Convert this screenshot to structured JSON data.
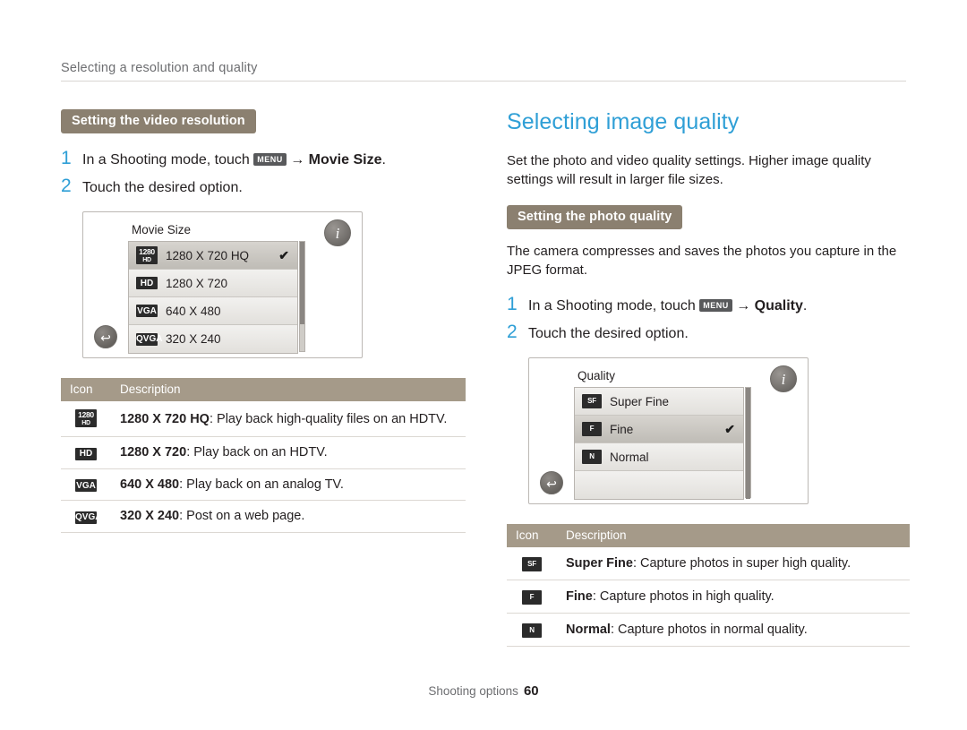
{
  "runhead": {
    "text": "Selecting a resolution and quality"
  },
  "left": {
    "section_tab": "Setting the video resolution",
    "steps": [
      {
        "num": "1",
        "pre": "In a Shooting mode, touch",
        "chip": "MENU",
        "arrow": "→",
        "bold": "Movie Size",
        "post": "."
      },
      {
        "num": "2",
        "pre": "Touch the desired option.",
        "chip": "",
        "arrow": "",
        "bold": "",
        "post": ""
      }
    ],
    "screen": {
      "title": "Movie Size",
      "info_label": "i",
      "back_label": "↩",
      "options": [
        {
          "icon_top": "1280",
          "icon_bottom": "HD",
          "icon_type": "res",
          "label": "1280 X 720 HQ",
          "selected": true,
          "check": "✔"
        },
        {
          "icon_top": "HD",
          "icon_bottom": "",
          "icon_type": "hd",
          "label": "1280 X 720",
          "selected": false,
          "check": ""
        },
        {
          "icon_top": "VGA",
          "icon_bottom": "",
          "icon_type": "hd",
          "label": "640 X 480",
          "selected": false,
          "check": ""
        },
        {
          "icon_top": "QVGA",
          "icon_bottom": "",
          "icon_type": "hd",
          "label": "320 X 240",
          "selected": false,
          "check": ""
        }
      ]
    },
    "table": {
      "headers": [
        "Icon",
        "Description"
      ],
      "rows": [
        {
          "icon_top": "1280",
          "icon_bottom": "HD",
          "icon_type": "res",
          "bold": "1280 X 720 HQ",
          "text": ": Play back high-quality files on an HDTV."
        },
        {
          "icon_top": "HD",
          "icon_bottom": "",
          "icon_type": "hd",
          "bold": "1280 X 720",
          "text": ": Play back on an HDTV."
        },
        {
          "icon_top": "VGA",
          "icon_bottom": "",
          "icon_type": "hd",
          "bold": "640 X 480",
          "text": ": Play back on an analog TV."
        },
        {
          "icon_top": "QVGA",
          "icon_bottom": "",
          "icon_type": "hd",
          "bold": "320 X 240",
          "text": ": Post on a web page."
        }
      ]
    }
  },
  "right": {
    "title": "Selecting image quality",
    "intro": "Set the photo and video quality settings. Higher image quality settings will result in larger file sizes.",
    "section_tab": "Setting the photo quality",
    "after_tab": "The camera compresses and saves the photos you capture in the JPEG format.",
    "steps": [
      {
        "num": "1",
        "pre": "In a Shooting mode, touch",
        "chip": "MENU",
        "arrow": "→",
        "bold": "Quality",
        "post": "."
      },
      {
        "num": "2",
        "pre": "Touch the desired option.",
        "chip": "",
        "arrow": "",
        "bold": "",
        "post": ""
      }
    ],
    "screen": {
      "title": "Quality",
      "info_label": "i",
      "back_label": "↩",
      "options": [
        {
          "icon_label": "SF",
          "label": "Super Fine",
          "selected": false,
          "check": ""
        },
        {
          "icon_label": "F",
          "label": "Fine",
          "selected": true,
          "check": "✔"
        },
        {
          "icon_label": "N",
          "label": "Normal",
          "selected": false,
          "check": ""
        }
      ]
    },
    "table": {
      "headers": [
        "Icon",
        "Description"
      ],
      "rows": [
        {
          "icon_label": "SF",
          "bold": "Super Fine",
          "text": ": Capture photos in super high quality."
        },
        {
          "icon_label": "F",
          "bold": "Fine",
          "text": ": Capture photos in high quality."
        },
        {
          "icon_label": "N",
          "bold": "Normal",
          "text": ": Capture photos in normal quality."
        }
      ]
    }
  },
  "footer": {
    "label": "Shooting options",
    "page": "60"
  },
  "colors": {
    "accent_blue": "#2f9fd6",
    "tab_brown": "#8b8070",
    "table_header": "#a59a89",
    "body": "#231f20"
  }
}
